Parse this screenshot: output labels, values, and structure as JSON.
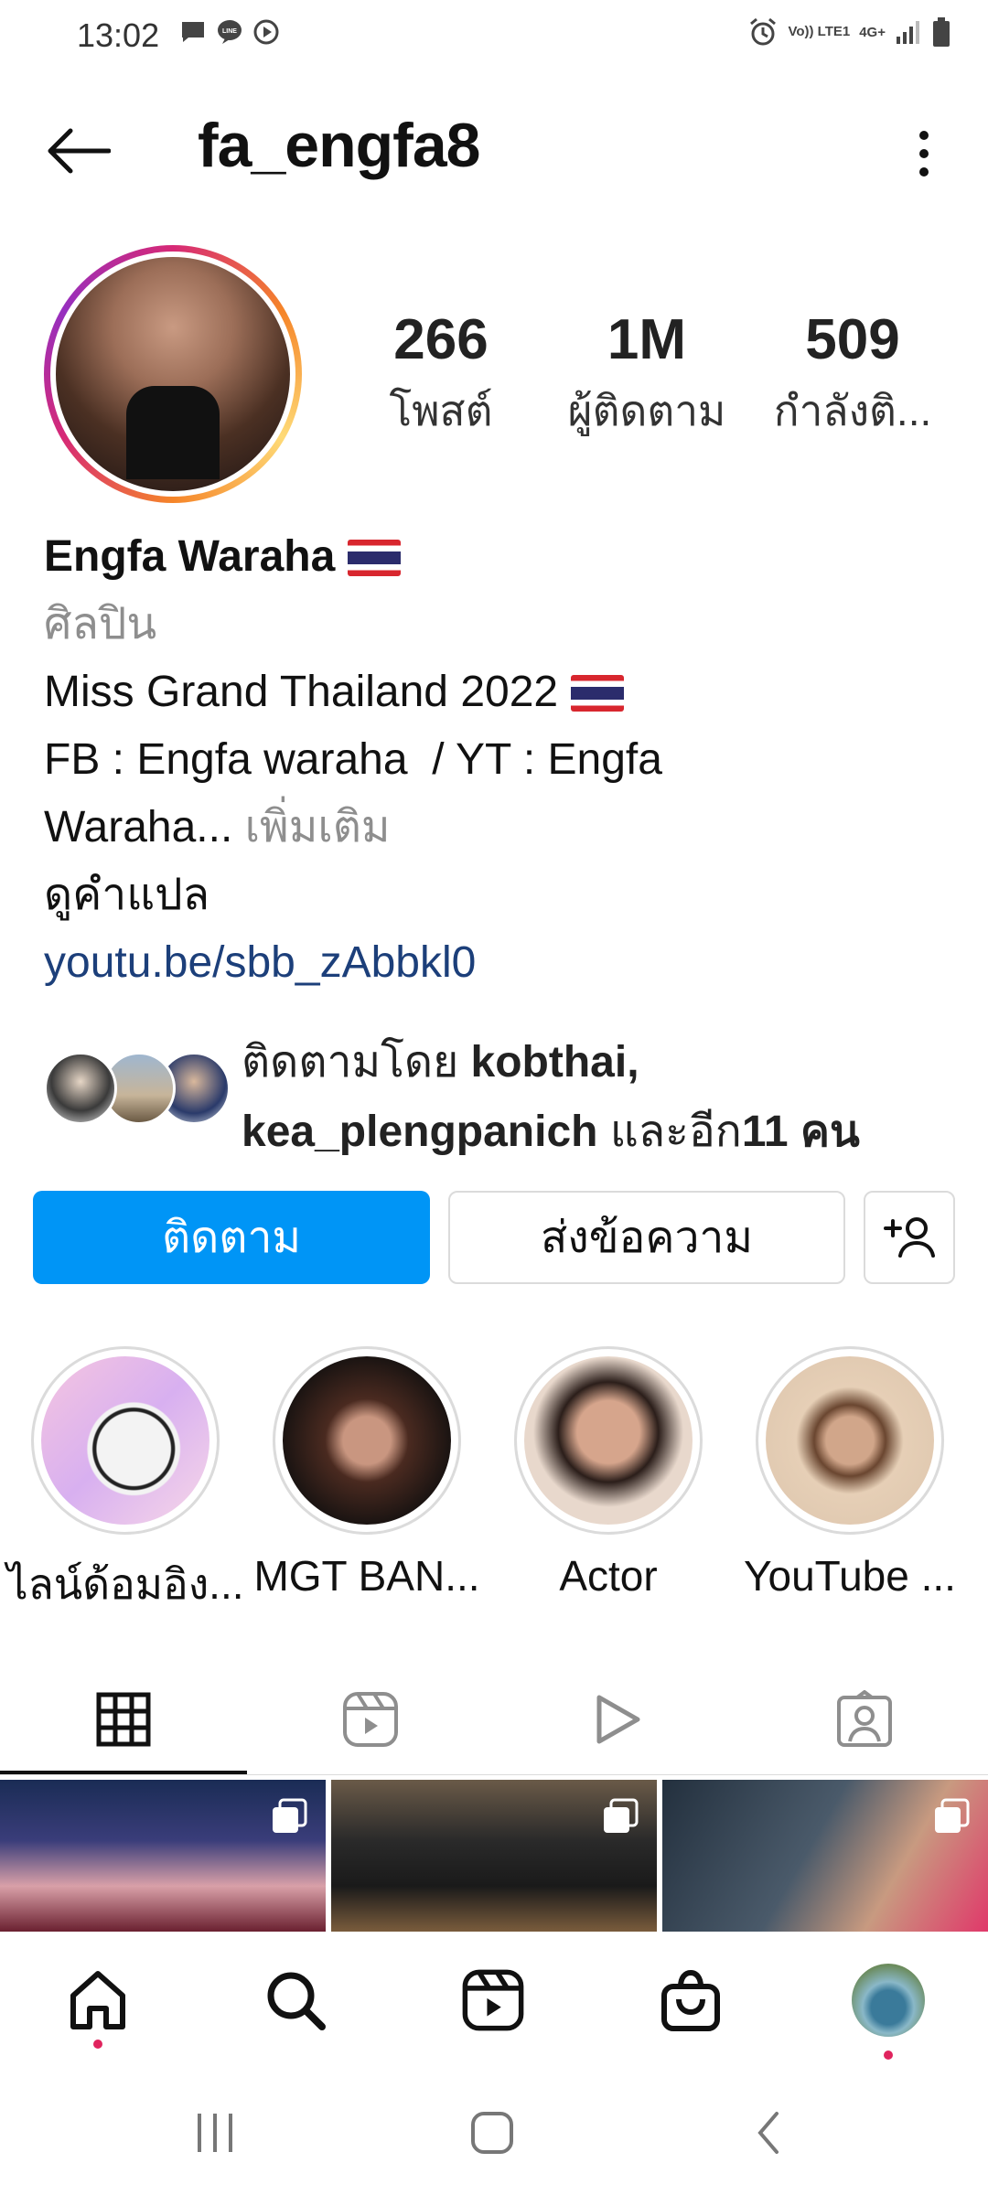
{
  "status_bar": {
    "time": "13:02",
    "left_icons": [
      "chat-bubble-icon",
      "line-icon",
      "play-icon"
    ],
    "right_icons": [
      "alarm-icon",
      "volte-icon",
      "network-4g-icon",
      "signal-icon",
      "battery-icon"
    ],
    "network_text": "Vo)) LTE1",
    "network_type": "4G+"
  },
  "header": {
    "username": "fa_engfa8",
    "back_icon": "arrow-left-icon",
    "more_icon": "more-vertical-icon"
  },
  "profile": {
    "stats": [
      {
        "value": "266",
        "label": "โพสต์"
      },
      {
        "value": "1M",
        "label": "ผู้ติดตาม"
      },
      {
        "value": "509",
        "label": "กำลังติ..."
      }
    ],
    "name": "Engfa Waraha",
    "category": "ศิลปิน",
    "bio_line1": "Miss Grand Thailand 2022",
    "bio_line2": "FB : Engfa waraha  / YT : Engfa",
    "bio_line3": "Waraha...",
    "more_label": "เพิ่มเติม",
    "translate_label": "ดูคำแปล",
    "link": "youtu.be/sbb_zAbbkl0"
  },
  "followed_by": {
    "prefix": "ติดตามโดย",
    "user1": "kobthai,",
    "user2": "kea_plengpanich",
    "and_more": "และอีก",
    "count": "11 คน"
  },
  "actions": {
    "follow_label": "ติดตาม",
    "message_label": "ส่งข้อความ",
    "add_icon": "add-person-icon"
  },
  "highlights": [
    {
      "label": "ไลน์ด้อมอิง..."
    },
    {
      "label": "MGT BAN..."
    },
    {
      "label": "Actor"
    },
    {
      "label": "YouTube ..."
    }
  ],
  "tabs": [
    "grid-icon",
    "reels-icon",
    "video-icon",
    "tagged-icon"
  ],
  "bottom_nav": [
    "home-icon",
    "search-icon",
    "reels-icon",
    "shop-icon",
    "profile-avatar"
  ],
  "colors": {
    "accent": "#0095f6",
    "link": "#1c3f7a",
    "muted": "#8e8e8e",
    "notification_dot": "#e0245e"
  }
}
